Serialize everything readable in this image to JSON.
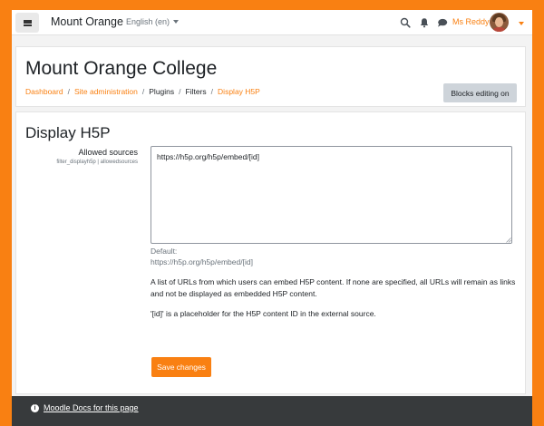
{
  "navbar": {
    "site_name": "Mount Orange",
    "language": "English (en)",
    "user_name": "Ms Reddy"
  },
  "header": {
    "page_heading": "Mount Orange College",
    "breadcrumb": [
      "Dashboard",
      "Site administration",
      "Plugins",
      "Filters",
      "Display H5P"
    ],
    "blocks_button": "Blocks editing on"
  },
  "settings": {
    "section_title": "Display H5P",
    "field_label": "Allowed sources",
    "field_name": "filter_displayh5p | allowedsources",
    "field_value": "https://h5p.org/h5p/embed/[id]",
    "default_label": "Default:",
    "default_value": "https://h5p.org/h5p/embed/[id]",
    "description_1": "A list of URLs from which users can embed H5P content. If none are specified, all URLs will remain as links and not be displayed as embedded H5P content.",
    "description_2": "'[id]' is a placeholder for the H5P content ID in the external source.",
    "save_button": "Save changes"
  },
  "footer": {
    "docs_link": "Moodle Docs for this page"
  },
  "colors": {
    "accent": "#f98012",
    "footer_bg": "#373a3c",
    "page_bg": "#f3f3f3"
  },
  "icons": [
    "menu-icon",
    "caret-down-icon",
    "search-icon",
    "bell-icon",
    "chat-icon",
    "avatar",
    "info-icon"
  ]
}
